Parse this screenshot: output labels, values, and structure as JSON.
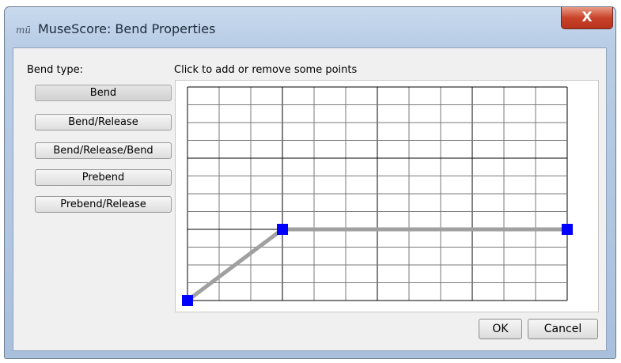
{
  "window": {
    "title": "MuseScore: Bend Properties",
    "close_label": "X"
  },
  "bend_type": {
    "label": "Bend type:",
    "selected": "Bend",
    "options": [
      "Bend",
      "Bend/Release",
      "Bend/Release/Bend",
      "Prebend",
      "Prebend/Release"
    ]
  },
  "canvas": {
    "hint": "Click to add or remove some points",
    "columns": 12,
    "rows": 12,
    "points": [
      {
        "col": 0,
        "row": 0
      },
      {
        "col": 3,
        "row": 4
      },
      {
        "col": 12,
        "row": 4
      }
    ],
    "line_color": "#a0a0a0",
    "point_color": "#0000ff"
  },
  "buttons": {
    "ok": "OK",
    "cancel": "Cancel"
  }
}
